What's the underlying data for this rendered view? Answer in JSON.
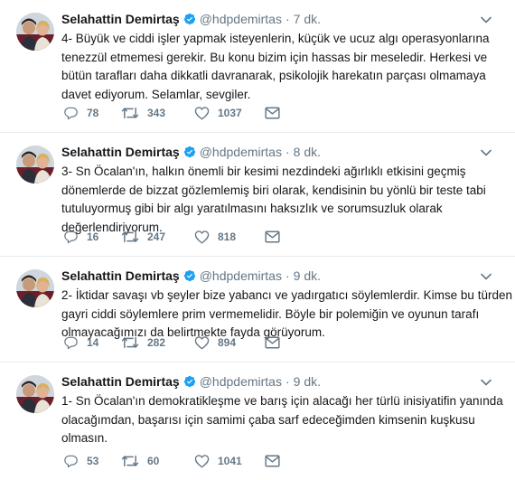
{
  "tweets": [
    {
      "name": "Selahattin Demirtaş",
      "handle": "@hdpdemirtas",
      "separator": "·",
      "time": "7 dk.",
      "lines": [
        "4- Büyük ve ciddi işler yapmak isteyenlerin, küçük ve ucuz algı operasyonlarına",
        "tenezzül etmemesi gerekir. Bu konu bizim için hassas bir meseledir. Herkesi ve",
        "bütün tarafları daha dikkatli davranarak, psikolojik harekatın parçası olmamaya",
        "davet ediyorum. Selamlar, sevgiler."
      ],
      "replies": "78",
      "retweets": "343",
      "likes": "1037"
    },
    {
      "name": "Selahattin Demirtaş",
      "handle": "@hdpdemirtas",
      "separator": "·",
      "time": "8 dk.",
      "lines": [
        "3- Sn Öcalan'ın, halkın önemli bir kesimi nezdindeki ağırlıklı etkisini geçmiş",
        "dönemlerde de bizzat gözlemlemiş biri olarak, kendisinin bu yönlü bir teste tabi",
        "tutuluyormuş gibi bir algı yaratılmasını haksızlık ve sorumsuzluk olarak",
        "değerlendiriyorum."
      ],
      "replies": "16",
      "retweets": "247",
      "likes": "818"
    },
    {
      "name": "Selahattin Demirtaş",
      "handle": "@hdpdemirtas",
      "separator": "·",
      "time": "9 dk.",
      "lines": [
        "2- İktidar savaşı vb şeyler bize yabancı ve yadırgatıcı söylemlerdir. Kimse bu türden",
        "gayri ciddi söylemlere prim vermemelidir. Böyle bir polemiğin ve oyunun tarafı",
        "olmayacağımızı da belirtmekte fayda görüyorum."
      ],
      "replies": "14",
      "retweets": "282",
      "likes": "894"
    },
    {
      "name": "Selahattin Demirtaş",
      "handle": "@hdpdemirtas",
      "separator": "·",
      "time": "9 dk.",
      "lines": [
        "1- Sn Öcalan'ın demokratikleşme ve barış için alacağı her türlü inisiyatifin yanında",
        "olacağımdan, başarısı için samimi çaba sarf edeceğimden kimsenin kuşkusu",
        "olmasın."
      ],
      "replies": "53",
      "retweets": "60",
      "likes": "1041"
    }
  ],
  "icons": {
    "verified": "verified-badge-icon",
    "caret": "chevron-down-icon",
    "reply": "reply-icon",
    "retweet": "retweet-icon",
    "like": "heart-icon",
    "message": "envelope-icon"
  },
  "colors": {
    "text": "#14171a",
    "muted": "#657786",
    "verified": "#1da1f2",
    "divider": "#e6ecf0"
  }
}
